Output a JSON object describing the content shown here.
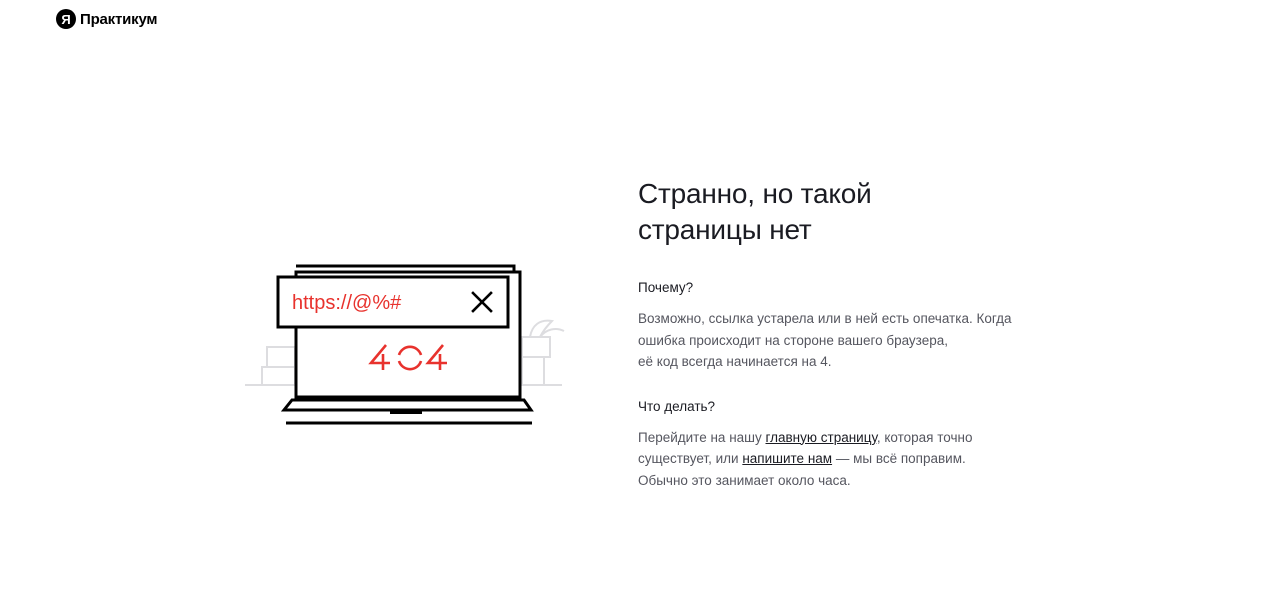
{
  "header": {
    "logo_mark": "Я",
    "logo_text": "Практикум"
  },
  "illustration": {
    "url_text": "https://@%#",
    "code_digit_1": "4",
    "code_digit_3": "4",
    "accent_color": "#e8322d",
    "close_icon": "close-icon"
  },
  "main": {
    "title_line1": "Странно, но такой",
    "title_line2": "страницы нет",
    "why_heading": "Почему?",
    "why_line1": "Возможно, ссылка устарела или в ней есть опечатка. Когда",
    "why_line2": "ошибка происходит на стороне вашего браузера,",
    "why_line3": "её код всегда начинается на 4.",
    "todo_heading": "Что делать?",
    "todo_line1_prefix": "Перейдите на нашу ",
    "todo_link_main": "главную страницу",
    "todo_line1_suffix": ", которая точно",
    "todo_line2_prefix": "существует, или ",
    "todo_link_write": "напишите нам",
    "todo_line2_suffix": " — мы всё поправим.",
    "todo_line3": "Обычно это занимает около часа."
  }
}
